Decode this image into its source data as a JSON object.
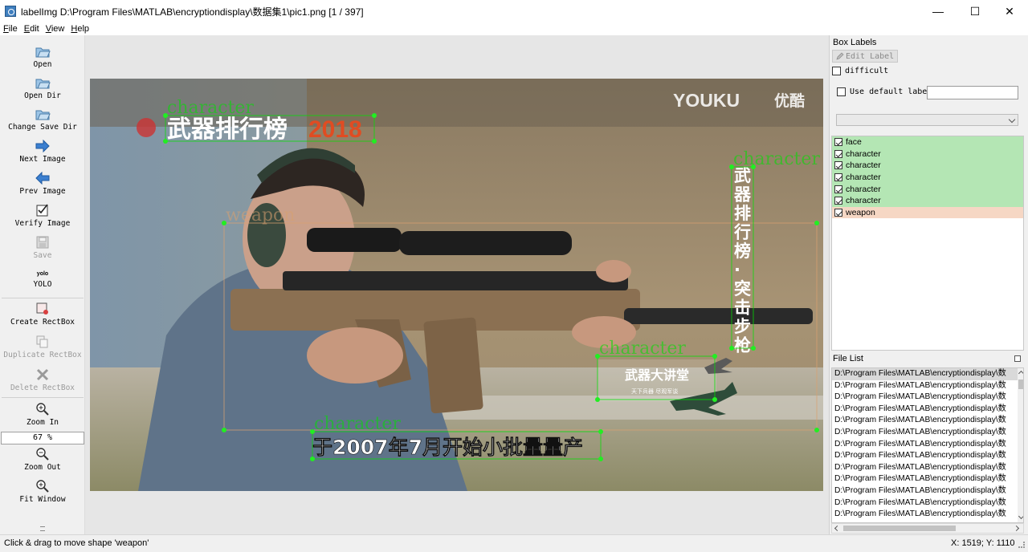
{
  "window": {
    "title": "labelImg D:\\Program Files\\MATLAB\\encryptiondisplay\\数据集1\\pic1.png [1 / 397]",
    "minimize": "—",
    "maximize": "☐",
    "close": "✕"
  },
  "menu": [
    {
      "first": "F",
      "rest": "ile"
    },
    {
      "first": "E",
      "rest": "dit"
    },
    {
      "first": "V",
      "rest": "iew"
    },
    {
      "first": "H",
      "rest": "elp"
    }
  ],
  "toolbar": {
    "open": "Open",
    "open_dir": "Open Dir",
    "change_save_dir": "Change Save Dir",
    "next_image": "Next Image",
    "prev_image": "Prev Image",
    "verify_image": "Verify Image",
    "save": "Save",
    "yolo_icon_text": "yolo",
    "yolo": "YOLO",
    "create_rectbox": "Create RectBox",
    "duplicate_rectbox": "Duplicate RectBox",
    "delete_rectbox": "Delete RectBox",
    "zoom_in": "Zoom In",
    "zoom_value": "67 %",
    "zoom_out": "Zoom Out",
    "fit_window": "Fit Window"
  },
  "canvas": {
    "box_labels": [
      "character",
      "weapon",
      "character",
      "character",
      "character"
    ],
    "overlay_texts": {
      "watermark_brand": "YOUKU",
      "watermark_cn": "优酷",
      "title_banner": "武器排行榜",
      "title_year": "2018",
      "vertical_caption": [
        "武",
        "器",
        "排",
        "行",
        "榜",
        "·",
        "突",
        "击",
        "步",
        "枪"
      ],
      "badge_title": "武器大讲堂",
      "badge_sub": "天下兵器 尽观军谈",
      "subtitle": "于2007年7月开始小批量量产"
    },
    "box_color": "#00e000",
    "weapon_box_color": "#d8a070"
  },
  "dock": {
    "box_labels_title": "Box Labels",
    "edit_label": "Edit Label",
    "difficult": "difficult",
    "use_default_label": "Use default label",
    "labels": [
      {
        "text": "face",
        "color": "#b4e6b4",
        "checked": true
      },
      {
        "text": "character",
        "color": "#b4e6b4",
        "checked": true
      },
      {
        "text": "character",
        "color": "#b4e6b4",
        "checked": true
      },
      {
        "text": "character",
        "color": "#b4e6b4",
        "checked": true
      },
      {
        "text": "character",
        "color": "#b4e6b4",
        "checked": true
      },
      {
        "text": "character",
        "color": "#b4e6b4",
        "checked": true
      },
      {
        "text": "weapon",
        "color": "#f6d7c4",
        "checked": true
      }
    ],
    "file_list_title": "File List",
    "files": [
      "D:\\Program Files\\MATLAB\\encryptiondisplay\\数",
      "D:\\Program Files\\MATLAB\\encryptiondisplay\\数",
      "D:\\Program Files\\MATLAB\\encryptiondisplay\\数",
      "D:\\Program Files\\MATLAB\\encryptiondisplay\\数",
      "D:\\Program Files\\MATLAB\\encryptiondisplay\\数",
      "D:\\Program Files\\MATLAB\\encryptiondisplay\\数",
      "D:\\Program Files\\MATLAB\\encryptiondisplay\\数",
      "D:\\Program Files\\MATLAB\\encryptiondisplay\\数",
      "D:\\Program Files\\MATLAB\\encryptiondisplay\\数",
      "D:\\Program Files\\MATLAB\\encryptiondisplay\\数",
      "D:\\Program Files\\MATLAB\\encryptiondisplay\\数",
      "D:\\Program Files\\MATLAB\\encryptiondisplay\\数",
      "D:\\Program Files\\MATLAB\\encryptiondisplay\\数"
    ]
  },
  "status": {
    "message": "Click & drag to move shape 'weapon'",
    "coords": "X: 1519; Y: 1110"
  }
}
